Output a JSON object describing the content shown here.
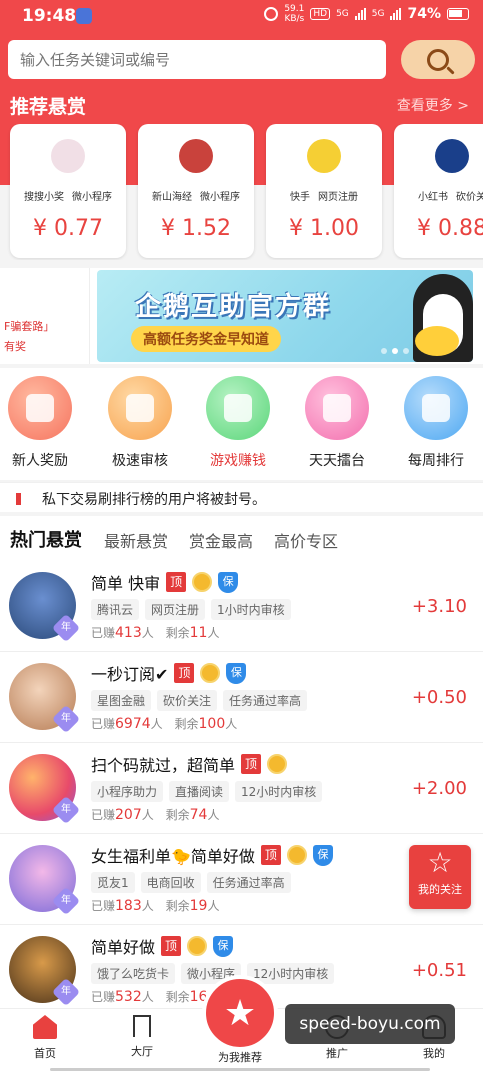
{
  "status_bar": {
    "time": "19:48",
    "net_speed": "59.1",
    "net_unit": "KB/s",
    "hd": "HD",
    "sig1": "5G",
    "sig2": "5G",
    "battery": "74%"
  },
  "search": {
    "placeholder": "输入任务关键词或编号",
    "button_icon": "search-icon"
  },
  "recommend": {
    "title": "推荐悬赏",
    "more": "查看更多 >",
    "cards": [
      {
        "tags": [
          "搜搜小奖",
          "微小程序"
        ],
        "price": "¥ 0.77",
        "logo_color": "#f1dfe6"
      },
      {
        "tags": [
          "新山海经",
          "微小程序"
        ],
        "price": "¥ 1.52",
        "logo_color": "#c9423c"
      },
      {
        "tags": [
          "快手",
          "网页注册"
        ],
        "price": "¥ 1.00",
        "logo_color": "#f5cf34"
      },
      {
        "tags": [
          "小红书",
          "砍价关"
        ],
        "price": "¥ 0.88",
        "logo_color": "#1a3f8a"
      }
    ]
  },
  "banner": {
    "left_line1": "F骗套路」",
    "left_line2": "有奖",
    "title": "企鹅互助官方群",
    "subtitle": "高额任务奖金早知道"
  },
  "quick_actions": [
    {
      "label": "新人奖励",
      "color": "#f6745f",
      "highlight": false
    },
    {
      "label": "极速审核",
      "color": "#f7a34f",
      "highlight": false
    },
    {
      "label": "游戏赚钱",
      "color": "#5bd67a",
      "highlight": true
    },
    {
      "label": "天天擂台",
      "color": "#f36fae",
      "highlight": false
    },
    {
      "label": "每周排行",
      "color": "#4ea8f2",
      "highlight": false
    }
  ],
  "notice": {
    "text": "私下交易刷排行榜的用户将被封号。"
  },
  "tabs": [
    "热门悬赏",
    "最新悬赏",
    "赏金最高",
    "高价专区"
  ],
  "tasks": [
    {
      "title": "简单 快审",
      "tags": [
        "腾讯云",
        "网页注册",
        "1小时内审核"
      ],
      "earned_prefix": "已赚",
      "earned": "413",
      "earned_suffix": "人",
      "left_prefix": "剩余",
      "left": "11",
      "left_suffix": "人",
      "reward": "+3.10",
      "bao": true,
      "avatar": "#2b4a7a"
    },
    {
      "title": "一秒订阅✔",
      "tags": [
        "星图金融",
        "砍价关注",
        "任务通过率高"
      ],
      "earned_prefix": "已赚",
      "earned": "6974",
      "earned_suffix": "人",
      "left_prefix": "剩余",
      "left": "100",
      "left_suffix": "人",
      "reward": "+0.50",
      "bao": true,
      "avatar": "#d9a27b"
    },
    {
      "title": "扫个码就过，超简单",
      "tags": [
        "小程序助力",
        "直播阅读",
        "12小时内审核"
      ],
      "earned_prefix": "已赚",
      "earned": "207",
      "earned_suffix": "人",
      "left_prefix": "剩余",
      "left": "74",
      "left_suffix": "人",
      "reward": "+2.00",
      "bao": false,
      "avatar": "#ef6a5b"
    },
    {
      "title": "女生福利单🐤简单好做",
      "tags": [
        "觅友1",
        "电商回收",
        "任务通过率高"
      ],
      "earned_prefix": "已赚",
      "earned": "183",
      "earned_suffix": "人",
      "left_prefix": "剩余",
      "left": "19",
      "left_suffix": "人",
      "reward": "",
      "bao": true,
      "avatar": "#c07ad8"
    },
    {
      "title": "简单好做",
      "tags": [
        "饿了么吃货卡",
        "微小程序",
        "12小时内审核"
      ],
      "earned_prefix": "已赚",
      "earned": "532",
      "earned_suffix": "人",
      "left_prefix": "剩余",
      "left": "16",
      "left_suffix": "",
      "reward": "+0.51",
      "bao": true,
      "avatar": "#6b4a2a"
    }
  ],
  "badges": {
    "ding": "顶",
    "bao": "保",
    "year": "年"
  },
  "follow_button": {
    "label": "我的关注",
    "icon": "star-icon"
  },
  "bottom_nav": {
    "home": "首页",
    "hall": "大厅",
    "recommend": "为我推荐",
    "promote": "推广",
    "mine": "我的"
  },
  "watermark": "speed-boyu.com"
}
